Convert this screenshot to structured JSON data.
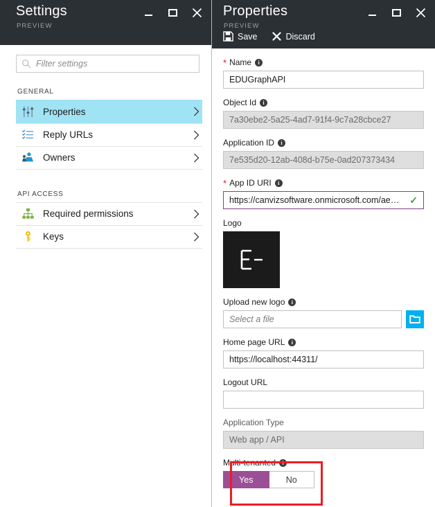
{
  "settings_blade": {
    "title": "Settings",
    "subtitle": "PREVIEW",
    "window_controls": {
      "minimize": "minimize-icon",
      "maximize": "maximize-icon",
      "close": "close-icon"
    },
    "filter": {
      "placeholder": "Filter settings",
      "value": "",
      "icon": "search-icon"
    },
    "groups": [
      {
        "title": "GENERAL",
        "items": [
          {
            "label": "Properties",
            "icon": "sliders-icon",
            "active": true
          },
          {
            "label": "Reply URLs",
            "icon": "list-icon",
            "active": false
          },
          {
            "label": "Owners",
            "icon": "people-icon",
            "active": false
          }
        ]
      },
      {
        "title": "API ACCESS",
        "items": [
          {
            "label": "Required permissions",
            "icon": "hierarchy-icon",
            "active": false
          },
          {
            "label": "Keys",
            "icon": "key-icon",
            "active": false
          }
        ]
      }
    ]
  },
  "properties_blade": {
    "title": "Properties",
    "subtitle": "PREVIEW",
    "toolbar": {
      "save_label": "Save",
      "save_icon": "save-icon",
      "discard_label": "Discard",
      "discard_icon": "discard-icon"
    },
    "fields": {
      "name": {
        "label": "Name",
        "required": true,
        "value": "EDUGraphAPI"
      },
      "object_id": {
        "label": "Object Id",
        "required": false,
        "value": "7a30ebe2-5a25-4ad7-91f4-9c7a28cbce27"
      },
      "application_id": {
        "label": "Application ID",
        "required": false,
        "value": "7e535d20-12ab-408d-b75e-0ad207373434"
      },
      "app_id_uri": {
        "label": "App ID URI",
        "required": true,
        "value": "https://canvizsoftware.onmicrosoft.com/ae…"
      },
      "logo": {
        "label": "Logo",
        "glyph": "E-"
      },
      "upload_new_logo": {
        "label": "Upload new logo",
        "placeholder": "Select a file",
        "value": "",
        "browse_icon": "folder-icon"
      },
      "home_page_url": {
        "label": "Home page URL",
        "value": "https://localhost:44311/"
      },
      "logout_url": {
        "label": "Logout URL",
        "value": ""
      },
      "application_type": {
        "label": "Application Type",
        "value": "Web app / API"
      },
      "multi_tenanted": {
        "label": "Multi-tenanted",
        "yes_label": "Yes",
        "no_label": "No",
        "selected": "Yes"
      }
    }
  },
  "annotation": {
    "highlight_color": "#ed1c24",
    "target": "multi-tenanted"
  },
  "colors": {
    "header_bg": "#2b3034",
    "active_nav": "#9fe3f5",
    "accent_purple": "#9b4f96",
    "browse_blue": "#00b0f0",
    "valid_green": "#3d9b35",
    "required_red": "#e81123"
  }
}
